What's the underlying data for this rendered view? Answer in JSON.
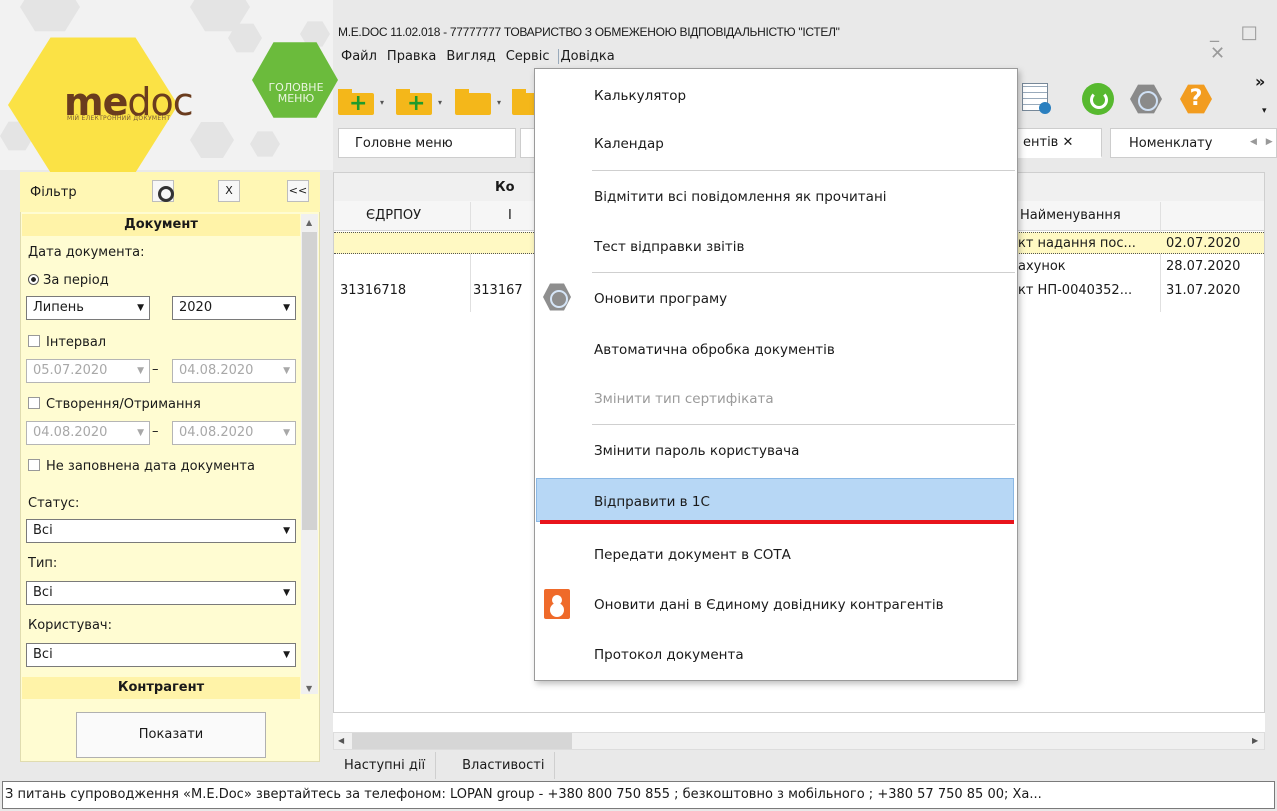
{
  "window": {
    "title": "M.E.DOC 11.02.018 - 77777777 ТОВАРИСТВО З ОБМЕЖЕНОЮ ВІДПОВІДАЛЬНІСТЮ \"ІСТЕЛ\"",
    "controls": "_ □ ✕"
  },
  "logo": {
    "part1": "me",
    "part2": "doc",
    "subtitle": "МІЙ ЕЛЕКТРОННИЙ ДОКУМЕНТ"
  },
  "main_menu_button": "ГОЛОВНЕ МЕНЮ",
  "menubar": [
    "Файл",
    "Правка",
    "Вигляд",
    "Сервіс",
    "Довідка"
  ],
  "toolbar": {
    "more": "»"
  },
  "tabs": {
    "main": "Головне меню",
    "docs": "ентів ✕",
    "nomenclature": "Номенклату"
  },
  "filter": {
    "title": "Фільтр",
    "close": "X",
    "collapse": "<<",
    "section_document": "Документ",
    "date_label": "Дата документа:",
    "period_radio": "За період",
    "month": "Липень",
    "year": "2020",
    "interval_label": "Інтервал",
    "interval_from": "05.07.2020",
    "interval_to": "04.08.2020",
    "created_label": "Створення/Отримання",
    "created_from": "04.08.2020",
    "created_to": "04.08.2020",
    "no_date_label": "Не заповнена дата документа",
    "status_label": "Статус:",
    "status_value": "Всі",
    "type_label": "Тип:",
    "type_value": "Всі",
    "user_label": "Користувач:",
    "user_value": "Всі",
    "section_contractor": "Контрагент",
    "show_button": "Показати"
  },
  "grid": {
    "band_label": "Ко",
    "headers": {
      "edrpou": "ЄДРПОУ",
      "ipn": "І",
      "name": "Найменування"
    },
    "rows": [
      {
        "edrpou": "",
        "ipn": "",
        "name": "кт надання пос...",
        "date": "02.07.2020"
      },
      {
        "edrpou": "",
        "ipn": "",
        "name": "ахунок",
        "date": "28.07.2020"
      },
      {
        "edrpou": "31316718",
        "ipn": "313167",
        "name": "кт НП-0040352...",
        "date": "31.07.2020"
      }
    ]
  },
  "bottom_tabs": [
    "Наступні дії",
    "Властивості"
  ],
  "statusbar": "З питань супроводження «M.E.Doc» звертайтесь за телефоном:  LOPAN group  - +380 800 750 855 ;  безкоштовно з мобільного ; +380 57 750 85 00;  Ха...",
  "service_menu": [
    {
      "label": "Калькулятор"
    },
    {
      "label": "Календар"
    },
    {
      "label": "Відмітити всі повідомлення як прочитані"
    },
    {
      "label": "Тест відправки звітів"
    },
    {
      "label": "Оновити програму",
      "icon": "update-shield-icon"
    },
    {
      "label": "Автоматична обробка документів"
    },
    {
      "label": "Змінити тип сертифіката",
      "disabled": true
    },
    {
      "label": "Змінити пароль користувача"
    },
    {
      "label": "Відправити в 1С",
      "highlighted": true
    },
    {
      "label": "Передати документ в СОТА"
    },
    {
      "label": "Оновити дані в Єдиному довіднику контрагентів",
      "icon": "contacts-book-icon"
    },
    {
      "label": "Протокол документа"
    }
  ],
  "colors": {
    "accent_yellow": "#fbe245",
    "main_menu_green": "#6bbb3c",
    "highlight": "#b7d7f5",
    "underline_red": "#e8141c"
  }
}
